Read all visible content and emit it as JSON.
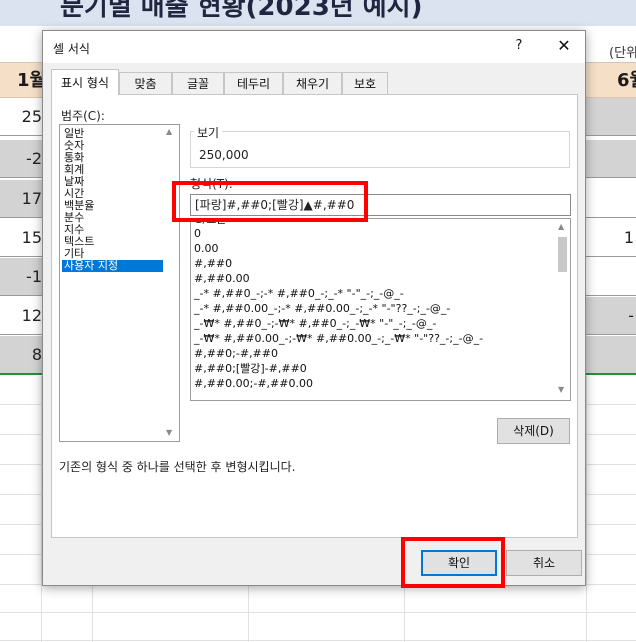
{
  "sheet": {
    "title_partial": "분기별 매출 현황(2023년 예시)",
    "unit_partial": "(단위",
    "left_header": "1월",
    "right_header": "6월",
    "left_column": [
      "25",
      "-2",
      "17",
      "15",
      "-1",
      "12",
      "8"
    ],
    "right_column": [
      "",
      "",
      "",
      "1",
      "",
      "-",
      ""
    ],
    "colors": {
      "header_bg": "#f5dfc7",
      "gray_row": "#d3d3d3",
      "green_border": "#2e8b3a"
    }
  },
  "dialog": {
    "title": "셀 서식",
    "help_label": "?",
    "close_label": "✕",
    "tabs": [
      "표시 형식",
      "맞춤",
      "글꼴",
      "테두리",
      "채우기",
      "보호"
    ],
    "active_tab": "표시 형식",
    "category_label": "범주(C):",
    "categories": [
      "일반",
      "숫자",
      "통화",
      "회계",
      "날짜",
      "시간",
      "백분율",
      "분수",
      "지수",
      "텍스트",
      "기타",
      "사용자 지정"
    ],
    "selected_category": "사용자 지정",
    "sample_label": "보기",
    "sample_value": "250,000",
    "type_label": "형식(T):",
    "type_value": "[파랑]#,##0;[빨강]▲#,##0",
    "format_list": [
      "G/표준",
      "0",
      "0.00",
      "#,##0",
      "#,##0.00",
      "_-* #,##0_-;-* #,##0_-;_-* \"-\"_-;_-@_-",
      "_-* #,##0.00_-;-* #,##0.00_-;_-* \"-\"??_-;_-@_-",
      "_-₩* #,##0_-;-₩* #,##0_-;_-₩* \"-\"_-;_-@_-",
      "_-₩* #,##0.00_-;-₩* #,##0.00_-;_-₩* \"-\"??_-;_-@_-",
      "#,##0;-#,##0",
      "#,##0;[빨강]-#,##0",
      "#,##0.00;-#,##0.00"
    ],
    "delete_button": "삭제(D)",
    "description": "기존의 형식 중 하나를 선택한 후 변형시킵니다.",
    "ok_button": "확인",
    "cancel_button": "취소",
    "icons": {
      "scroll_up": "chevron-up-icon",
      "scroll_down": "chevron-down-icon"
    },
    "highlight_color": "#ff0000",
    "selection_color": "#0078d7"
  }
}
